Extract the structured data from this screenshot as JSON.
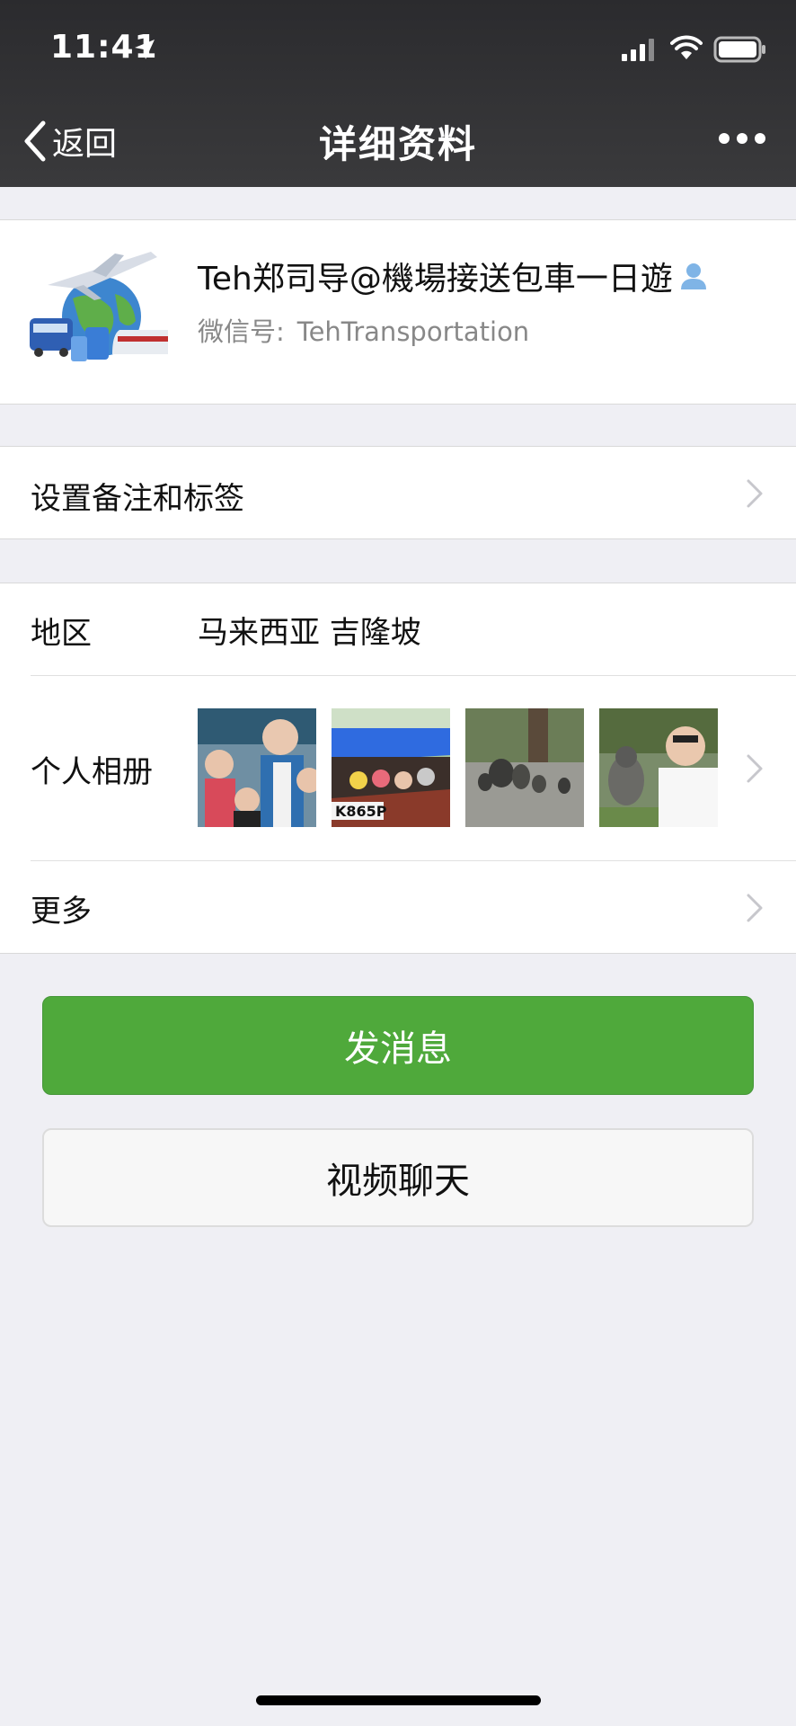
{
  "status_bar": {
    "time": "11:41"
  },
  "nav": {
    "back_label": "返回",
    "title": "详细资料"
  },
  "profile": {
    "name": "Teh郑司导@機場接送包車一日遊",
    "wechat_id_label": "微信号:",
    "wechat_id": "TehTransportation"
  },
  "remark_row": {
    "label": "设置备注和标签"
  },
  "region_row": {
    "label": "地区",
    "value": "马来西亚 吉隆坡"
  },
  "album_row": {
    "label": "个人相册",
    "thumb_plate_text": "K865P"
  },
  "more_row": {
    "label": "更多"
  },
  "actions": {
    "message_label": "发消息",
    "video_call_label": "视频聊天"
  },
  "colors": {
    "header_bg": "#2e2e30",
    "page_bg": "#efeff4",
    "primary_green": "#4fa93b"
  }
}
